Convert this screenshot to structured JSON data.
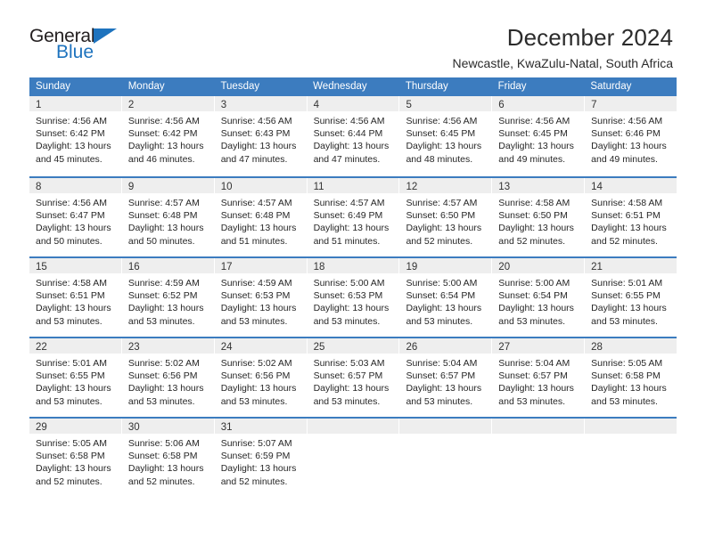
{
  "brand": {
    "name_part1": "General",
    "name_part2": "Blue",
    "logo_icon": "blue-triangle-icon"
  },
  "header": {
    "title": "December 2024",
    "subtitle": "Newcastle, KwaZulu-Natal, South Africa"
  },
  "colors": {
    "header_blue": "#3c7cbf",
    "brand_blue": "#1e73be",
    "day_band_gray": "#eeeeee",
    "text": "#262626"
  },
  "calendar": {
    "weekdays": [
      "Sunday",
      "Monday",
      "Tuesday",
      "Wednesday",
      "Thursday",
      "Friday",
      "Saturday"
    ],
    "weeks": [
      [
        {
          "day": "1",
          "sunrise": "Sunrise: 4:56 AM",
          "sunset": "Sunset: 6:42 PM",
          "daylight1": "Daylight: 13 hours",
          "daylight2": "and 45 minutes."
        },
        {
          "day": "2",
          "sunrise": "Sunrise: 4:56 AM",
          "sunset": "Sunset: 6:42 PM",
          "daylight1": "Daylight: 13 hours",
          "daylight2": "and 46 minutes."
        },
        {
          "day": "3",
          "sunrise": "Sunrise: 4:56 AM",
          "sunset": "Sunset: 6:43 PM",
          "daylight1": "Daylight: 13 hours",
          "daylight2": "and 47 minutes."
        },
        {
          "day": "4",
          "sunrise": "Sunrise: 4:56 AM",
          "sunset": "Sunset: 6:44 PM",
          "daylight1": "Daylight: 13 hours",
          "daylight2": "and 47 minutes."
        },
        {
          "day": "5",
          "sunrise": "Sunrise: 4:56 AM",
          "sunset": "Sunset: 6:45 PM",
          "daylight1": "Daylight: 13 hours",
          "daylight2": "and 48 minutes."
        },
        {
          "day": "6",
          "sunrise": "Sunrise: 4:56 AM",
          "sunset": "Sunset: 6:45 PM",
          "daylight1": "Daylight: 13 hours",
          "daylight2": "and 49 minutes."
        },
        {
          "day": "7",
          "sunrise": "Sunrise: 4:56 AM",
          "sunset": "Sunset: 6:46 PM",
          "daylight1": "Daylight: 13 hours",
          "daylight2": "and 49 minutes."
        }
      ],
      [
        {
          "day": "8",
          "sunrise": "Sunrise: 4:56 AM",
          "sunset": "Sunset: 6:47 PM",
          "daylight1": "Daylight: 13 hours",
          "daylight2": "and 50 minutes."
        },
        {
          "day": "9",
          "sunrise": "Sunrise: 4:57 AM",
          "sunset": "Sunset: 6:48 PM",
          "daylight1": "Daylight: 13 hours",
          "daylight2": "and 50 minutes."
        },
        {
          "day": "10",
          "sunrise": "Sunrise: 4:57 AM",
          "sunset": "Sunset: 6:48 PM",
          "daylight1": "Daylight: 13 hours",
          "daylight2": "and 51 minutes."
        },
        {
          "day": "11",
          "sunrise": "Sunrise: 4:57 AM",
          "sunset": "Sunset: 6:49 PM",
          "daylight1": "Daylight: 13 hours",
          "daylight2": "and 51 minutes."
        },
        {
          "day": "12",
          "sunrise": "Sunrise: 4:57 AM",
          "sunset": "Sunset: 6:50 PM",
          "daylight1": "Daylight: 13 hours",
          "daylight2": "and 52 minutes."
        },
        {
          "day": "13",
          "sunrise": "Sunrise: 4:58 AM",
          "sunset": "Sunset: 6:50 PM",
          "daylight1": "Daylight: 13 hours",
          "daylight2": "and 52 minutes."
        },
        {
          "day": "14",
          "sunrise": "Sunrise: 4:58 AM",
          "sunset": "Sunset: 6:51 PM",
          "daylight1": "Daylight: 13 hours",
          "daylight2": "and 52 minutes."
        }
      ],
      [
        {
          "day": "15",
          "sunrise": "Sunrise: 4:58 AM",
          "sunset": "Sunset: 6:51 PM",
          "daylight1": "Daylight: 13 hours",
          "daylight2": "and 53 minutes."
        },
        {
          "day": "16",
          "sunrise": "Sunrise: 4:59 AM",
          "sunset": "Sunset: 6:52 PM",
          "daylight1": "Daylight: 13 hours",
          "daylight2": "and 53 minutes."
        },
        {
          "day": "17",
          "sunrise": "Sunrise: 4:59 AM",
          "sunset": "Sunset: 6:53 PM",
          "daylight1": "Daylight: 13 hours",
          "daylight2": "and 53 minutes."
        },
        {
          "day": "18",
          "sunrise": "Sunrise: 5:00 AM",
          "sunset": "Sunset: 6:53 PM",
          "daylight1": "Daylight: 13 hours",
          "daylight2": "and 53 minutes."
        },
        {
          "day": "19",
          "sunrise": "Sunrise: 5:00 AM",
          "sunset": "Sunset: 6:54 PM",
          "daylight1": "Daylight: 13 hours",
          "daylight2": "and 53 minutes."
        },
        {
          "day": "20",
          "sunrise": "Sunrise: 5:00 AM",
          "sunset": "Sunset: 6:54 PM",
          "daylight1": "Daylight: 13 hours",
          "daylight2": "and 53 minutes."
        },
        {
          "day": "21",
          "sunrise": "Sunrise: 5:01 AM",
          "sunset": "Sunset: 6:55 PM",
          "daylight1": "Daylight: 13 hours",
          "daylight2": "and 53 minutes."
        }
      ],
      [
        {
          "day": "22",
          "sunrise": "Sunrise: 5:01 AM",
          "sunset": "Sunset: 6:55 PM",
          "daylight1": "Daylight: 13 hours",
          "daylight2": "and 53 minutes."
        },
        {
          "day": "23",
          "sunrise": "Sunrise: 5:02 AM",
          "sunset": "Sunset: 6:56 PM",
          "daylight1": "Daylight: 13 hours",
          "daylight2": "and 53 minutes."
        },
        {
          "day": "24",
          "sunrise": "Sunrise: 5:02 AM",
          "sunset": "Sunset: 6:56 PM",
          "daylight1": "Daylight: 13 hours",
          "daylight2": "and 53 minutes."
        },
        {
          "day": "25",
          "sunrise": "Sunrise: 5:03 AM",
          "sunset": "Sunset: 6:57 PM",
          "daylight1": "Daylight: 13 hours",
          "daylight2": "and 53 minutes."
        },
        {
          "day": "26",
          "sunrise": "Sunrise: 5:04 AM",
          "sunset": "Sunset: 6:57 PM",
          "daylight1": "Daylight: 13 hours",
          "daylight2": "and 53 minutes."
        },
        {
          "day": "27",
          "sunrise": "Sunrise: 5:04 AM",
          "sunset": "Sunset: 6:57 PM",
          "daylight1": "Daylight: 13 hours",
          "daylight2": "and 53 minutes."
        },
        {
          "day": "28",
          "sunrise": "Sunrise: 5:05 AM",
          "sunset": "Sunset: 6:58 PM",
          "daylight1": "Daylight: 13 hours",
          "daylight2": "and 53 minutes."
        }
      ],
      [
        {
          "day": "29",
          "sunrise": "Sunrise: 5:05 AM",
          "sunset": "Sunset: 6:58 PM",
          "daylight1": "Daylight: 13 hours",
          "daylight2": "and 52 minutes."
        },
        {
          "day": "30",
          "sunrise": "Sunrise: 5:06 AM",
          "sunset": "Sunset: 6:58 PM",
          "daylight1": "Daylight: 13 hours",
          "daylight2": "and 52 minutes."
        },
        {
          "day": "31",
          "sunrise": "Sunrise: 5:07 AM",
          "sunset": "Sunset: 6:59 PM",
          "daylight1": "Daylight: 13 hours",
          "daylight2": "and 52 minutes."
        },
        {
          "day": "",
          "sunrise": "",
          "sunset": "",
          "daylight1": "",
          "daylight2": ""
        },
        {
          "day": "",
          "sunrise": "",
          "sunset": "",
          "daylight1": "",
          "daylight2": ""
        },
        {
          "day": "",
          "sunrise": "",
          "sunset": "",
          "daylight1": "",
          "daylight2": ""
        },
        {
          "day": "",
          "sunrise": "",
          "sunset": "",
          "daylight1": "",
          "daylight2": ""
        }
      ]
    ]
  }
}
